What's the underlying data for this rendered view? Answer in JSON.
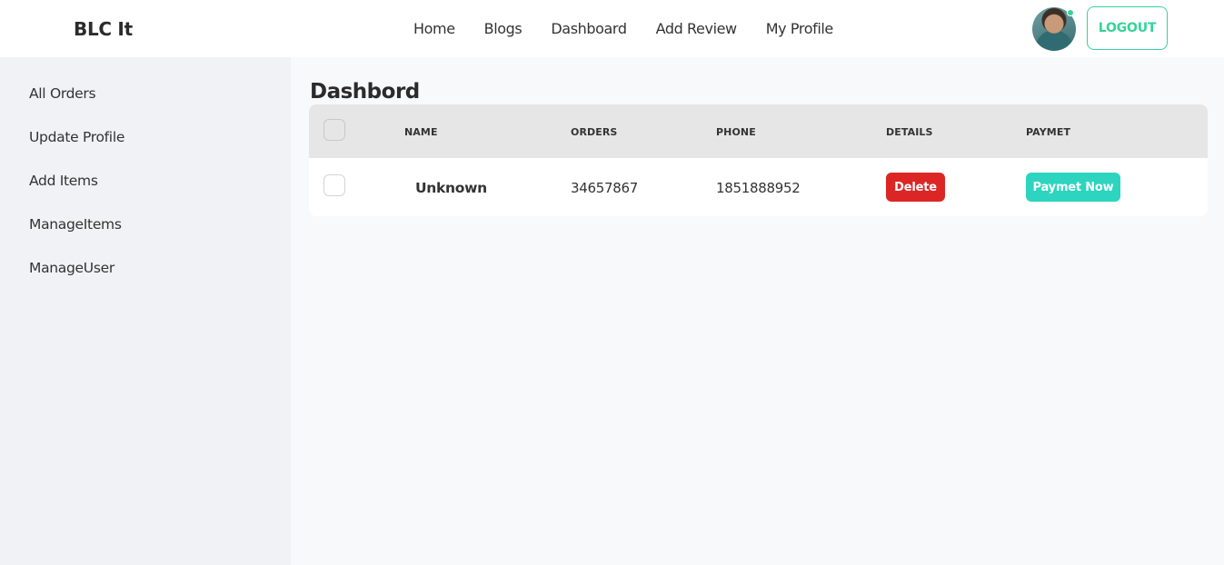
{
  "navbar": {
    "brand": "BLC It",
    "links": [
      "Home",
      "Blogs",
      "Dashboard",
      "Add Review",
      "My Profile"
    ],
    "logout_label": "LOGOUT",
    "avatar_status": "online",
    "accent_color": "#36d399"
  },
  "sidebar": {
    "items": [
      "All Orders",
      "Update Profile",
      "Add Items",
      "ManageItems",
      "ManageUser"
    ]
  },
  "main": {
    "title": "Dashbord",
    "table": {
      "headers": [
        "NAME",
        "ORDERS",
        "PHONE",
        "DETAILS",
        "PAYMET"
      ],
      "rows": [
        {
          "name": "Unknown",
          "orders": "34657867",
          "phone": "1851888952",
          "details_action": "Delete",
          "payment_action": "Paymet Now"
        }
      ]
    }
  },
  "colors": {
    "delete": "#dc2626",
    "pay": "#2dd4bf",
    "header_bg": "#e6e6e6",
    "sidebar_bg": "#f0f2f5"
  }
}
